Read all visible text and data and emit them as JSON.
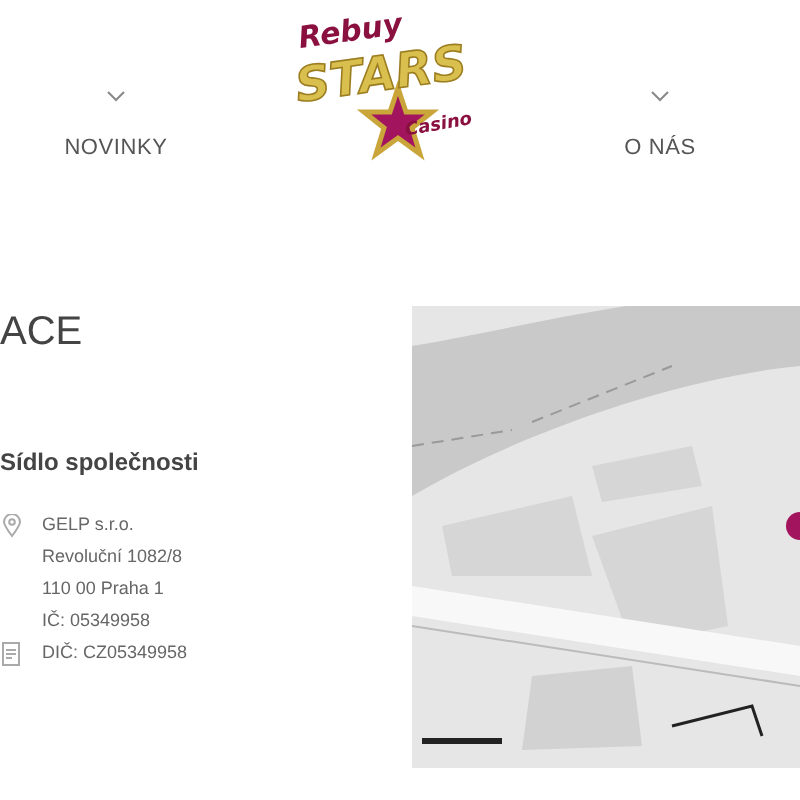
{
  "nav": [
    {
      "label": "NOVINKY"
    },
    {
      "label": "O NÁS"
    }
  ],
  "logo": {
    "line_1": "Rebuy",
    "line_2": "STARS",
    "line_3": "Casino"
  },
  "heading": "ACE",
  "company": {
    "title": "Sídlo společnosti",
    "lines": [
      {
        "text": "GELP s.r.o.",
        "kind": "address"
      },
      {
        "text": "Revoluční 1082/8",
        "kind": "plain"
      },
      {
        "text": "110 00 Praha 1",
        "kind": "plain"
      },
      {
        "text": "IČ: 05349958",
        "kind": "plain"
      },
      {
        "text": "DIČ: CZ05349958",
        "kind": "tax"
      }
    ]
  }
}
